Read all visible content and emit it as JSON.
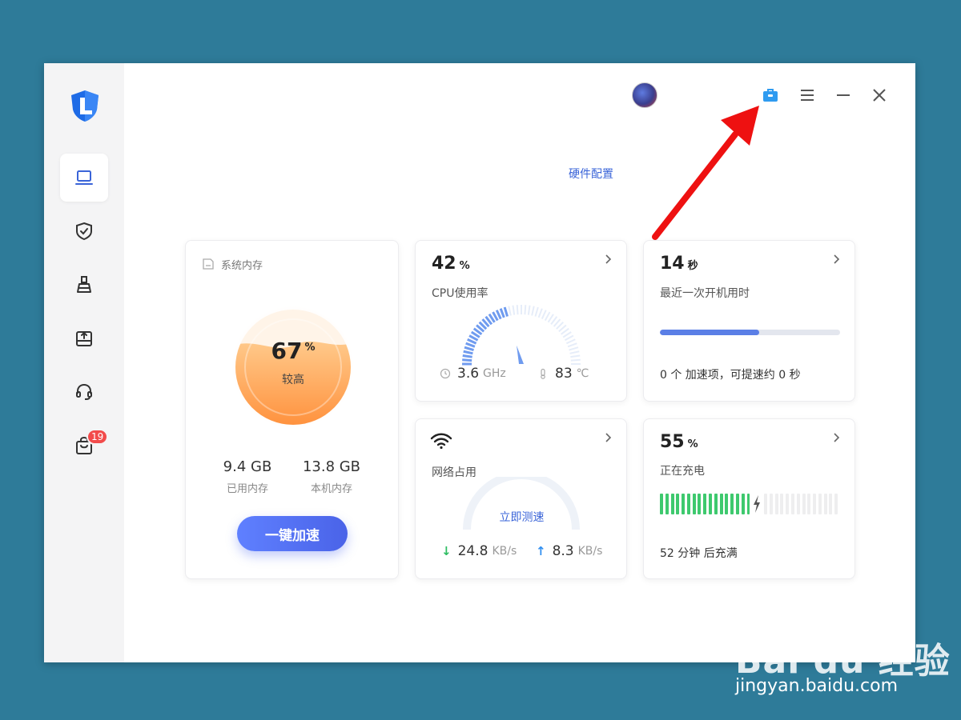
{
  "window": {
    "hardware_link": "硬件配置",
    "sidebar": {
      "items": [
        {
          "name": "laptop",
          "active": true
        },
        {
          "name": "shield-check",
          "active": false
        },
        {
          "name": "clean-brush",
          "active": false
        },
        {
          "name": "disk-upload",
          "active": false
        },
        {
          "name": "headset",
          "active": false
        },
        {
          "name": "bag",
          "active": false,
          "badge": "19"
        }
      ]
    }
  },
  "memory": {
    "title": "系统内存",
    "percent": "67",
    "percent_unit": "%",
    "level": "较高",
    "used_value": "9.4 GB",
    "used_label": "已用内存",
    "total_value": "13.8 GB",
    "total_label": "本机内存",
    "boost_button": "一键加速"
  },
  "cpu": {
    "percent": "42",
    "unit": "%",
    "label": "CPU使用率",
    "frequency": "3.6",
    "frequency_unit": "GHz",
    "temperature": "83",
    "temperature_unit": "℃"
  },
  "boot": {
    "seconds": "14",
    "unit": "秒",
    "label": "最近一次开机用时",
    "progress": 0.55,
    "summary": "0 个 加速项，可提速约 0 秒"
  },
  "network": {
    "label": "网络占用",
    "test_link": "立即测速",
    "download": "24.8",
    "download_unit": "KB/s",
    "upload": "8.3",
    "upload_unit": "KB/s"
  },
  "battery": {
    "percent": "55",
    "unit": "%",
    "status": "正在充电",
    "level": 0.55,
    "time_left": "52 分钟 后充满"
  },
  "watermark": {
    "brand": "Bai du 经验",
    "url": "jingyan.baidu.com"
  },
  "colors": {
    "accent": "#3a64d8",
    "battery_green": "#3ec96e",
    "annotation_red": "#ee1111",
    "toolbox_blue": "#2f9bf0"
  }
}
